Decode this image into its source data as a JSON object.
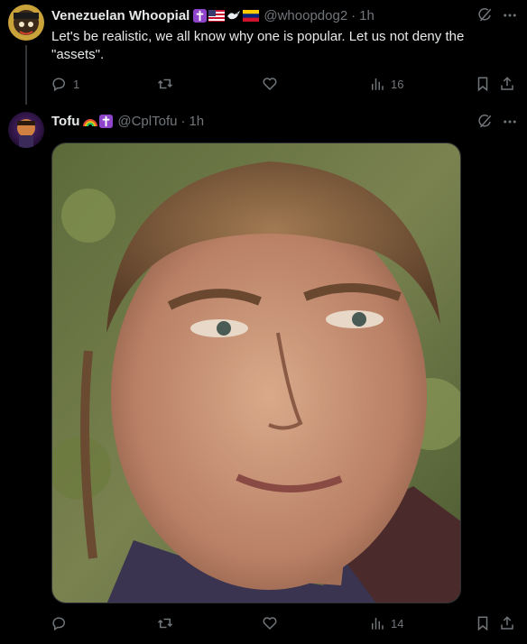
{
  "tweets": [
    {
      "display_name": "Venezuelan Whoopial",
      "handle": "@whoopdog2",
      "separator": "·",
      "time": "1h",
      "text": "Let's be realistic,  we all know why one is popular.  Let us not deny  the \"assets\".",
      "replies": "1",
      "views": "16",
      "badges": [
        "cross-emoji",
        "us-flag-emoji",
        "dove-emoji",
        "venezuela-flag-emoji"
      ]
    },
    {
      "display_name": "Tofu",
      "handle": "@CplTofu",
      "separator": "·",
      "time": "1h",
      "views": "14",
      "badges": [
        "rainbow-emoji",
        "cross-emoji"
      ],
      "media": "photo-young-man-closeup"
    }
  ],
  "colors": {
    "background": "#000000",
    "text": "#e7e9ea",
    "muted": "#71767b",
    "divider": "#2f3336"
  }
}
